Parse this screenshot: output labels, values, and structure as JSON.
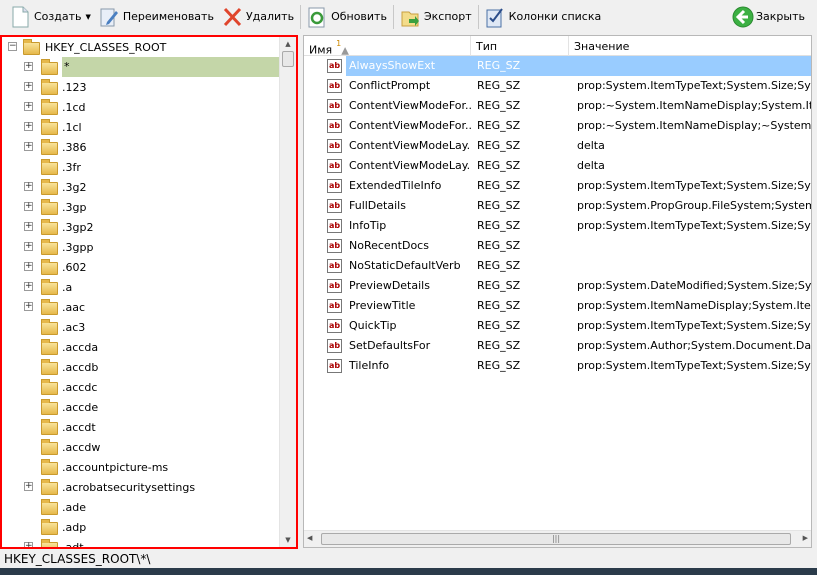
{
  "toolbar": {
    "create": "Создать",
    "rename": "Переименовать",
    "delete": "Удалить",
    "refresh": "Обновить",
    "export": "Экспорт",
    "columns": "Колонки списка",
    "close": "Закрыть"
  },
  "tree": {
    "root": "HKEY_CLASSES_ROOT",
    "items": [
      {
        "label": "*",
        "expandable": true,
        "selected": true
      },
      {
        "label": ".123",
        "expandable": true
      },
      {
        "label": ".1cd",
        "expandable": true
      },
      {
        "label": ".1cl",
        "expandable": true
      },
      {
        "label": ".386",
        "expandable": true
      },
      {
        "label": ".3fr",
        "expandable": false
      },
      {
        "label": ".3g2",
        "expandable": true
      },
      {
        "label": ".3gp",
        "expandable": true
      },
      {
        "label": ".3gp2",
        "expandable": true
      },
      {
        "label": ".3gpp",
        "expandable": true
      },
      {
        "label": ".602",
        "expandable": true
      },
      {
        "label": ".a",
        "expandable": true
      },
      {
        "label": ".aac",
        "expandable": true
      },
      {
        "label": ".ac3",
        "expandable": false
      },
      {
        "label": ".accda",
        "expandable": false
      },
      {
        "label": ".accdb",
        "expandable": false
      },
      {
        "label": ".accdc",
        "expandable": false
      },
      {
        "label": ".accde",
        "expandable": false
      },
      {
        "label": ".accdt",
        "expandable": false
      },
      {
        "label": ".accdw",
        "expandable": false
      },
      {
        "label": ".accountpicture-ms",
        "expandable": false
      },
      {
        "label": ".acrobatsecuritysettings",
        "expandable": true
      },
      {
        "label": ".ade",
        "expandable": false
      },
      {
        "label": ".adp",
        "expandable": false
      },
      {
        "label": ".adt",
        "expandable": true
      }
    ]
  },
  "list": {
    "columns": {
      "name": "Имя",
      "sort_index": "1",
      "type": "Тип",
      "value": "Значение"
    },
    "rows": [
      {
        "name": "AlwaysShowExt",
        "type": "REG_SZ",
        "value": "",
        "selected": true
      },
      {
        "name": "ConflictPrompt",
        "type": "REG_SZ",
        "value": "prop:System.ItemTypeText;System.Size;Syst..."
      },
      {
        "name": "ContentViewModeFor...",
        "type": "REG_SZ",
        "value": "prop:~System.ItemNameDisplay;System.Item..."
      },
      {
        "name": "ContentViewModeFor...",
        "type": "REG_SZ",
        "value": "prop:~System.ItemNameDisplay;~System.Ite..."
      },
      {
        "name": "ContentViewModeLay...",
        "type": "REG_SZ",
        "value": "delta"
      },
      {
        "name": "ContentViewModeLay...",
        "type": "REG_SZ",
        "value": "delta"
      },
      {
        "name": "ExtendedTileInfo",
        "type": "REG_SZ",
        "value": "prop:System.ItemTypeText;System.Size;Syst..."
      },
      {
        "name": "FullDetails",
        "type": "REG_SZ",
        "value": "prop:System.PropGroup.FileSystem;System.It..."
      },
      {
        "name": "InfoTip",
        "type": "REG_SZ",
        "value": "prop:System.ItemTypeText;System.Size;Syst..."
      },
      {
        "name": "NoRecentDocs",
        "type": "REG_SZ",
        "value": ""
      },
      {
        "name": "NoStaticDefaultVerb",
        "type": "REG_SZ",
        "value": ""
      },
      {
        "name": "PreviewDetails",
        "type": "REG_SZ",
        "value": "prop:System.DateModified;System.Size;Syste..."
      },
      {
        "name": "PreviewTitle",
        "type": "REG_SZ",
        "value": "prop:System.ItemNameDisplay;System.ItemTy..."
      },
      {
        "name": "QuickTip",
        "type": "REG_SZ",
        "value": "prop:System.ItemTypeText;System.Size;Syst..."
      },
      {
        "name": "SetDefaultsFor",
        "type": "REG_SZ",
        "value": "prop:System.Author;System.Document.DateC..."
      },
      {
        "name": "TileInfo",
        "type": "REG_SZ",
        "value": "prop:System.ItemTypeText;System.Size;Syst..."
      }
    ]
  },
  "status": {
    "path": "HKEY_CLASSES_ROOT\\*\\"
  },
  "colors": {
    "tree_selected": "#c4d6a8",
    "list_selected": "#99ccff",
    "border": "#ff0000"
  }
}
